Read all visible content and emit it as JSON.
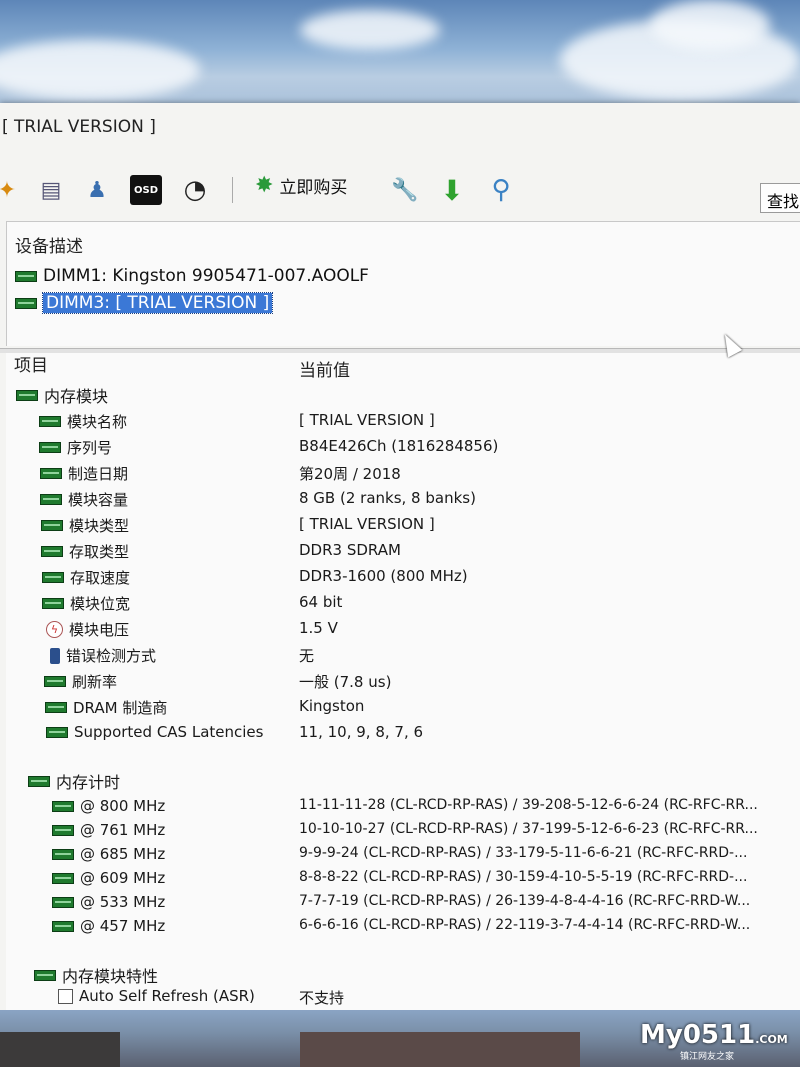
{
  "window": {
    "title": "[ TRIAL VERSION ]"
  },
  "toolbar": {
    "buy_label": "立即购买",
    "osd_label": "OSD",
    "search_label": "查找"
  },
  "device_panel": {
    "header": "设备描述",
    "items": [
      {
        "label": "DIMM1: Kingston 9905471-007.AOOLF",
        "selected": false
      },
      {
        "label": "DIMM3: [ TRIAL VERSION ]",
        "selected": true
      }
    ]
  },
  "details": {
    "col_item": "项目",
    "col_value": "当前值",
    "module_group": "内存模块",
    "module_rows": [
      {
        "label": "模块名称",
        "value": "[ TRIAL VERSION ]",
        "icon": "ram-icon"
      },
      {
        "label": "序列号",
        "value": "B84E426Ch (1816284856)",
        "icon": "ram-icon"
      },
      {
        "label": "制造日期",
        "value": "第20周 / 2018",
        "icon": "ram-icon"
      },
      {
        "label": "模块容量",
        "value": "8 GB (2 ranks, 8 banks)",
        "icon": "ram-icon"
      },
      {
        "label": "模块类型",
        "value": "[ TRIAL VERSION ]",
        "icon": "ram-icon"
      },
      {
        "label": "存取类型",
        "value": "DDR3 SDRAM",
        "icon": "ram-icon"
      },
      {
        "label": "存取速度",
        "value": "DDR3-1600 (800 MHz)",
        "icon": "ram-icon"
      },
      {
        "label": "模块位宽",
        "value": "64 bit",
        "icon": "ram-icon"
      },
      {
        "label": "模块电压",
        "value": "1.5 V",
        "icon": "voltage-icon"
      },
      {
        "label": "错误检测方式",
        "value": "无",
        "icon": "ecc-icon"
      },
      {
        "label": "刷新率",
        "value": "一般 (7.8 us)",
        "icon": "ram-icon"
      },
      {
        "label": "DRAM 制造商",
        "value": "Kingston",
        "icon": "ram-icon"
      },
      {
        "label": "Supported CAS Latencies",
        "value": "11, 10, 9, 8, 7, 6",
        "icon": "ram-icon"
      }
    ],
    "timing_group": "内存计时",
    "timing_rows": [
      {
        "label": "@ 800 MHz",
        "value": "11-11-11-28  (CL-RCD-RP-RAS) / 39-208-5-12-6-6-24  (RC-RFC-RR..."
      },
      {
        "label": "@ 761 MHz",
        "value": "10-10-10-27  (CL-RCD-RP-RAS) / 37-199-5-12-6-6-23  (RC-RFC-RR..."
      },
      {
        "label": "@ 685 MHz",
        "value": "9-9-9-24  (CL-RCD-RP-RAS) / 33-179-5-11-6-6-21  (RC-RFC-RRD-..."
      },
      {
        "label": "@ 609 MHz",
        "value": "8-8-8-22  (CL-RCD-RP-RAS) / 30-159-4-10-5-5-19  (RC-RFC-RRD-..."
      },
      {
        "label": "@ 533 MHz",
        "value": "7-7-7-19  (CL-RCD-RP-RAS) / 26-139-4-8-4-4-16  (RC-RFC-RRD-W..."
      },
      {
        "label": "@ 457 MHz",
        "value": "6-6-6-16  (CL-RCD-RP-RAS) / 22-119-3-7-4-4-14  (RC-RFC-RRD-W..."
      }
    ],
    "features_group": "内存模块特性",
    "feature_rows": [
      {
        "label": "Auto Self Refresh (ASR)",
        "value": "不支持"
      }
    ]
  },
  "watermark": {
    "main": "My0511",
    "domain": ".COM",
    "sub": "镇江网友之家"
  }
}
